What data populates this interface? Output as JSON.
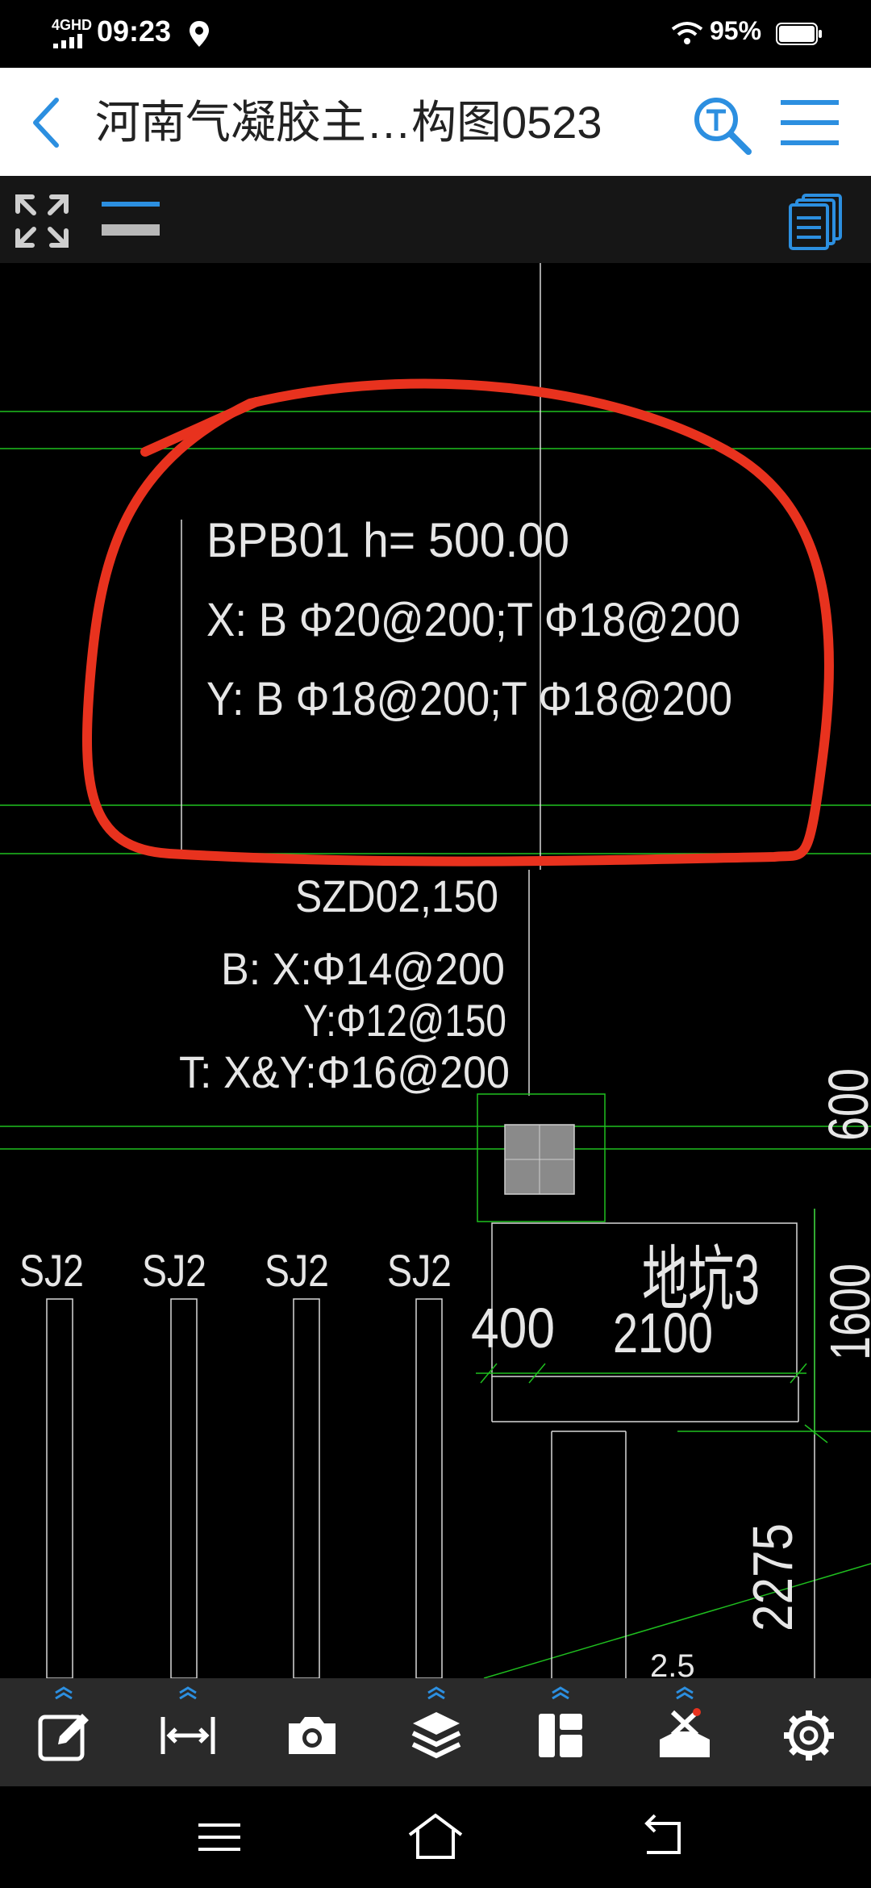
{
  "status": {
    "network": "4GHD",
    "time": "09:23",
    "battery": "95%"
  },
  "title_bar": {
    "title": "河南气凝胶主…构图0523"
  },
  "drawing": {
    "bpb_label": "BPB01 h= 500.00",
    "bpb_x": "X: B Φ20@200;T Φ18@200",
    "bpb_y": "Y: B Φ18@200;T Φ18@200",
    "szd_title": "SZD02,150",
    "szd_bx": "B: X:Φ14@200",
    "szd_by": "Y:Φ12@150",
    "szd_t": "T: X&Y:Φ16@200",
    "sj_labels": [
      "SJ2",
      "SJ2",
      "SJ2",
      "SJ2"
    ],
    "dim_400": "400",
    "dim_2100": "2100",
    "dim_600": "600",
    "dim_1600": "1600",
    "dim_2275": "2275",
    "pit_label": "地坑3",
    "partial_label": "2.5"
  },
  "colors": {
    "cad_background": "#000000",
    "grid_green": "#1fbf1f",
    "cad_white": "#e6e6e6",
    "annotation_red": "#e8321e",
    "icon_blue": "#2c8fe0"
  },
  "bottom_tools": [
    "edit-icon",
    "measure-icon",
    "camera-icon",
    "layers-icon",
    "layout-icon",
    "tools-icon",
    "settings-icon"
  ]
}
